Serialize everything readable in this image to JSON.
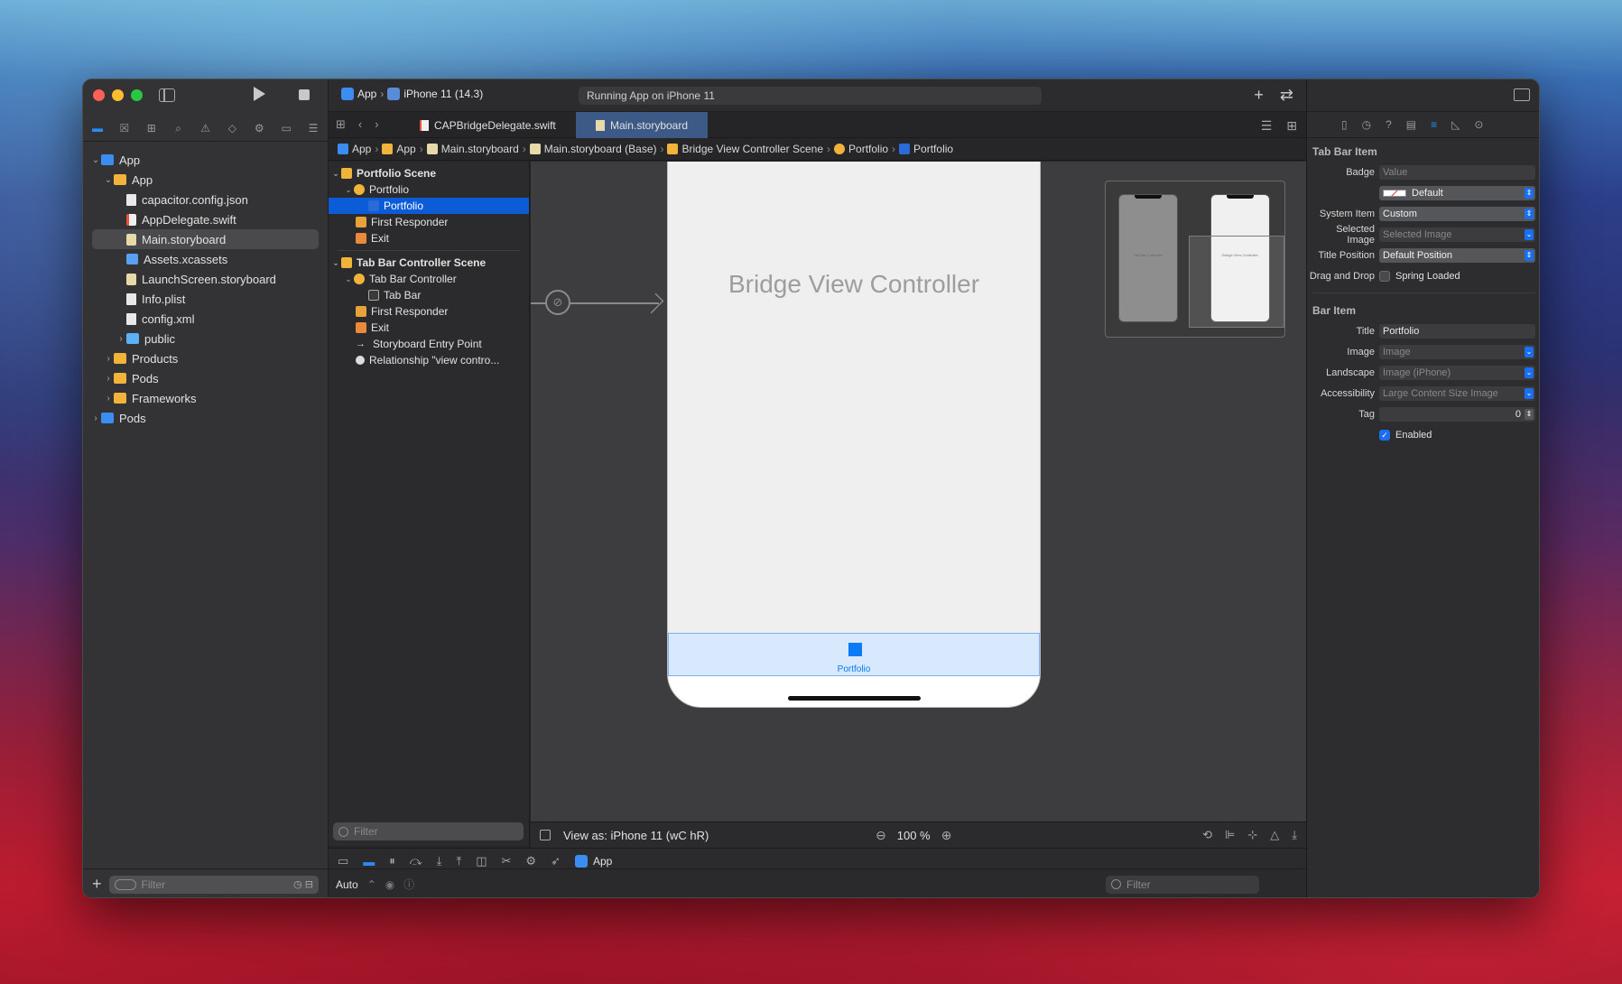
{
  "window": {
    "scheme_target": "App",
    "scheme_device": "iPhone 11 (14.3)",
    "activity": "Running App on iPhone 11"
  },
  "navigator": {
    "items": [
      {
        "label": "App",
        "level": 0,
        "icon": "project-icon",
        "expanded": true
      },
      {
        "label": "App",
        "level": 1,
        "icon": "folder-icon",
        "expanded": true
      },
      {
        "label": "capacitor.config.json",
        "level": 2,
        "icon": "file-icon"
      },
      {
        "label": "AppDelegate.swift",
        "level": 2,
        "icon": "swift-file-icon"
      },
      {
        "label": "Main.storyboard",
        "level": 2,
        "icon": "storyboard-icon",
        "selected": true
      },
      {
        "label": "Assets.xcassets",
        "level": 2,
        "icon": "asset-catalog-icon"
      },
      {
        "label": "LaunchScreen.storyboard",
        "level": 2,
        "icon": "storyboard-icon"
      },
      {
        "label": "Info.plist",
        "level": 2,
        "icon": "file-icon"
      },
      {
        "label": "config.xml",
        "level": 2,
        "icon": "file-icon"
      },
      {
        "label": "public",
        "level": 2,
        "icon": "folder-blue-icon",
        "collapsed": true
      },
      {
        "label": "Products",
        "level": 1,
        "icon": "folder-icon",
        "collapsed": true
      },
      {
        "label": "Pods",
        "level": 1,
        "icon": "folder-icon",
        "collapsed": true
      },
      {
        "label": "Frameworks",
        "level": 1,
        "icon": "folder-icon",
        "collapsed": true
      },
      {
        "label": "Pods",
        "level": 0,
        "icon": "project-icon",
        "collapsed": true
      }
    ],
    "filter_placeholder": "Filter"
  },
  "tabs": [
    {
      "label": "CAPBridgeDelegate.swift",
      "active": false
    },
    {
      "label": "Main.storyboard",
      "active": true
    }
  ],
  "jumpbar": [
    "App",
    "App",
    "Main.storyboard",
    "Main.storyboard (Base)",
    "Bridge View Controller Scene",
    "Portfolio",
    "Portfolio"
  ],
  "outline": {
    "scene1": "Portfolio Scene",
    "s1_vc": "Portfolio",
    "s1_item": "Portfolio",
    "s1_responder": "First Responder",
    "s1_exit": "Exit",
    "scene2": "Tab Bar Controller Scene",
    "s2_vc": "Tab Bar Controller",
    "s2_bar": "Tab Bar",
    "s2_responder": "First Responder",
    "s2_exit": "Exit",
    "s2_entry": "Storyboard Entry Point",
    "s2_rel": "Relationship \"view contro...",
    "filter_placeholder": "Filter"
  },
  "canvas": {
    "vc_title": "Bridge View Controller",
    "tab_item_label": "Portfolio",
    "minimap_label1": "Tab Bar Controller",
    "minimap_label2": "Bridge View Controller",
    "view_as": "View as: iPhone 11 (wC hR)",
    "zoom": "100 %"
  },
  "debug": {
    "app": "App",
    "console_mode": "Auto",
    "filter_placeholder": "Filter"
  },
  "inspector": {
    "section1": "Tab Bar Item",
    "badge_label": "Badge",
    "badge_placeholder": "Value",
    "badge_color": "Default",
    "system_item_label": "System Item",
    "system_item": "Custom",
    "selected_image_label": "Selected Image",
    "selected_image_placeholder": "Selected Image",
    "title_position_label": "Title Position",
    "title_position": "Default Position",
    "drag_drop_label": "Drag and Drop",
    "spring_loaded": "Spring Loaded",
    "section2": "Bar Item",
    "title_label": "Title",
    "title_value": "Portfolio",
    "image_label": "Image",
    "image_placeholder": "Image",
    "landscape_label": "Landscape",
    "landscape_placeholder": "Image (iPhone)",
    "accessibility_label": "Accessibility",
    "accessibility_placeholder": "Large Content Size Image",
    "tag_label": "Tag",
    "tag_value": "0",
    "enabled": "Enabled"
  },
  "colors": {
    "accent": "#0a7bf5",
    "selection": "#0b5cd6"
  }
}
